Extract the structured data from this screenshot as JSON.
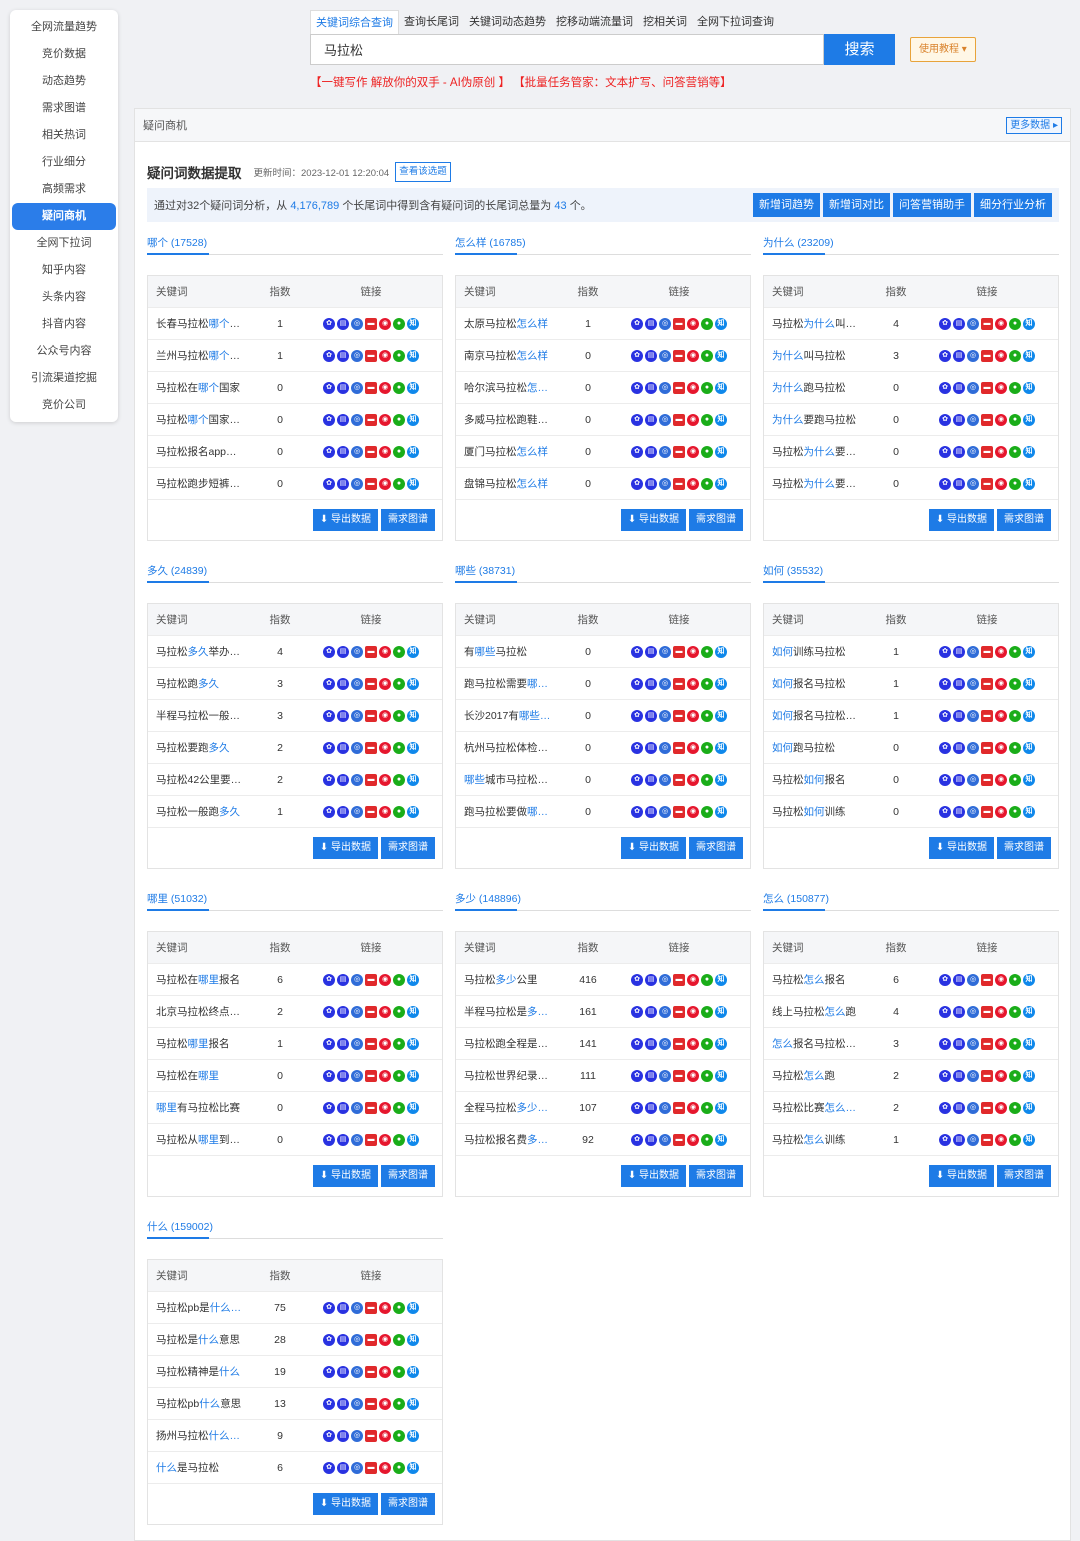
{
  "sidebar": {
    "items": [
      "全网流量趋势",
      "竞价数据",
      "动态趋势",
      "需求图谱",
      "相关热词",
      "行业细分",
      "高频需求",
      "疑问商机",
      "全网下拉词",
      "知乎内容",
      "头条内容",
      "抖音内容",
      "公众号内容",
      "引流渠道挖掘",
      "竞价公司"
    ],
    "active": "疑问商机"
  },
  "search": {
    "tabs": [
      "关键词综合查询",
      "查询长尾词",
      "关键词动态趋势",
      "挖移动端流量词",
      "挖相关词",
      "全网下拉词查询"
    ],
    "value": "马拉松",
    "button": "搜索",
    "tutorial": "使用教程 ▾",
    "promo1": "【一键写作 解放你的双手 - AI伪原创 】",
    "promo2": "【批量任务管家：文本扩写、问答营销等】"
  },
  "panel": {
    "title": "疑问商机",
    "more": "更多数据 ▸",
    "section_title": "疑问词数据提取",
    "update_time": "更新时间：2023-12-01 12:20:04",
    "view_button": "查看该选题",
    "summary_prefix": "通过对32个疑问词分析，从",
    "summary_total": "4,176,789",
    "summary_mid": "个长尾词中得到含有疑问词的长尾词总量为",
    "summary_count": "43",
    "summary_suffix": "个。",
    "buttons": [
      "新增词趋势",
      "新增词对比",
      "问答营销助手",
      "细分行业分析"
    ]
  },
  "table_labels": {
    "keyword": "关键词",
    "index": "指数",
    "link": "链接",
    "export": "导出数据",
    "graph": "需求图谱"
  },
  "link_icons": [
    {
      "name": "baidu-icon",
      "glyph": "✿",
      "color": "#2932e1"
    },
    {
      "name": "page-icon",
      "glyph": "▤",
      "color": "#2932e1"
    },
    {
      "name": "web-icon",
      "glyph": "◎",
      "color": "#2f6cd8"
    },
    {
      "name": "toutiao-icon",
      "glyph": "▬",
      "color": "#e0292b"
    },
    {
      "name": "weibo-icon",
      "glyph": "◉",
      "color": "#e6162d"
    },
    {
      "name": "wechat-icon",
      "glyph": "●",
      "color": "#1aad19"
    },
    {
      "name": "zhihu-icon",
      "glyph": "知",
      "color": "#0f88eb"
    }
  ],
  "groups": [
    {
      "title": "哪个 (17528)",
      "rows": [
        {
          "pre": "长春马拉松",
          "hl": "哪个",
          "post": "…",
          "idx": "1"
        },
        {
          "pre": "兰州马拉松",
          "hl": "哪个",
          "post": "…",
          "idx": "1"
        },
        {
          "pre": "马拉松在",
          "hl": "哪个",
          "post": "国家",
          "idx": "0"
        },
        {
          "pre": "马拉松",
          "hl": "哪个",
          "post": "国家…",
          "idx": "0"
        },
        {
          "pre": "马拉松报名app…",
          "hl": "",
          "post": "",
          "idx": "0"
        },
        {
          "pre": "马拉松跑步短裤…",
          "hl": "",
          "post": "",
          "idx": "0"
        }
      ]
    },
    {
      "title": "怎么样 (16785)",
      "rows": [
        {
          "pre": "太原马拉松",
          "hl": "怎么样",
          "post": "",
          "idx": "1"
        },
        {
          "pre": "南京马拉松",
          "hl": "怎么样",
          "post": "",
          "idx": "0"
        },
        {
          "pre": "哈尔滨马拉松",
          "hl": "怎…",
          "post": "",
          "idx": "0"
        },
        {
          "pre": "多威马拉松跑鞋…",
          "hl": "",
          "post": "",
          "idx": "0"
        },
        {
          "pre": "厦门马拉松",
          "hl": "怎么样",
          "post": "",
          "idx": "0"
        },
        {
          "pre": "盘锦马拉松",
          "hl": "怎么样",
          "post": "",
          "idx": "0"
        }
      ]
    },
    {
      "title": "为什么 (23209)",
      "rows": [
        {
          "pre": "马拉松",
          "hl": "为什么",
          "post": "叫…",
          "idx": "4"
        },
        {
          "pre": "",
          "hl": "为什么",
          "post": "叫马拉松",
          "idx": "3"
        },
        {
          "pre": "",
          "hl": "为什么",
          "post": "跑马拉松",
          "idx": "0"
        },
        {
          "pre": "",
          "hl": "为什么",
          "post": "要跑马拉松",
          "idx": "0"
        },
        {
          "pre": "马拉松",
          "hl": "为什么",
          "post": "要…",
          "idx": "0"
        },
        {
          "pre": "马拉松",
          "hl": "为什么",
          "post": "要…",
          "idx": "0"
        }
      ]
    },
    {
      "title": "多久 (24839)",
      "rows": [
        {
          "pre": "马拉松",
          "hl": "多久",
          "post": "举办…",
          "idx": "4"
        },
        {
          "pre": "马拉松跑",
          "hl": "多久",
          "post": "",
          "idx": "3"
        },
        {
          "pre": "半程马拉松一般…",
          "hl": "",
          "post": "",
          "idx": "3"
        },
        {
          "pre": "马拉松要跑",
          "hl": "多久",
          "post": "",
          "idx": "2"
        },
        {
          "pre": "马拉松42公里要…",
          "hl": "",
          "post": "",
          "idx": "2"
        },
        {
          "pre": "马拉松一般跑",
          "hl": "多久",
          "post": "",
          "idx": "1"
        }
      ]
    },
    {
      "title": "哪些 (38731)",
      "rows": [
        {
          "pre": "有",
          "hl": "哪些",
          "post": "马拉松",
          "idx": "0"
        },
        {
          "pre": "跑马拉松需要",
          "hl": "哪…",
          "post": "",
          "idx": "0"
        },
        {
          "pre": "长沙2017有",
          "hl": "哪些…",
          "post": "",
          "idx": "0"
        },
        {
          "pre": "杭州马拉松体检…",
          "hl": "",
          "post": "",
          "idx": "0"
        },
        {
          "pre": "",
          "hl": "哪些",
          "post": "城市马拉松…",
          "idx": "0"
        },
        {
          "pre": "跑马拉松要做",
          "hl": "哪…",
          "post": "",
          "idx": "0"
        }
      ]
    },
    {
      "title": "如何 (35532)",
      "rows": [
        {
          "pre": "",
          "hl": "如何",
          "post": "训练马拉松",
          "idx": "1"
        },
        {
          "pre": "",
          "hl": "如何",
          "post": "报名马拉松",
          "idx": "1"
        },
        {
          "pre": "",
          "hl": "如何",
          "post": "报名马拉松…",
          "idx": "1"
        },
        {
          "pre": "",
          "hl": "如何",
          "post": "跑马拉松",
          "idx": "0"
        },
        {
          "pre": "马拉松",
          "hl": "如何",
          "post": "报名",
          "idx": "0"
        },
        {
          "pre": "马拉松",
          "hl": "如何",
          "post": "训练",
          "idx": "0"
        }
      ]
    },
    {
      "title": "哪里 (51032)",
      "rows": [
        {
          "pre": "马拉松在",
          "hl": "哪里",
          "post": "报名",
          "idx": "6"
        },
        {
          "pre": "北京马拉松终点…",
          "hl": "",
          "post": "",
          "idx": "2"
        },
        {
          "pre": "马拉松",
          "hl": "哪里",
          "post": "报名",
          "idx": "1"
        },
        {
          "pre": "马拉松在",
          "hl": "哪里",
          "post": "",
          "idx": "0"
        },
        {
          "pre": "",
          "hl": "哪里",
          "post": "有马拉松比赛",
          "idx": "0"
        },
        {
          "pre": "马拉松从",
          "hl": "哪里",
          "post": "到…",
          "idx": "0"
        }
      ]
    },
    {
      "title": "多少 (148896)",
      "rows": [
        {
          "pre": "马拉松",
          "hl": "多少",
          "post": "公里",
          "idx": "416"
        },
        {
          "pre": "半程马拉松是",
          "hl": "多…",
          "post": "",
          "idx": "161"
        },
        {
          "pre": "马拉松跑全程是…",
          "hl": "",
          "post": "",
          "idx": "141"
        },
        {
          "pre": "马拉松世界纪录…",
          "hl": "",
          "post": "",
          "idx": "111"
        },
        {
          "pre": "全程马拉松",
          "hl": "多少…",
          "post": "",
          "idx": "107"
        },
        {
          "pre": "马拉松报名费",
          "hl": "多…",
          "post": "",
          "idx": "92"
        }
      ]
    },
    {
      "title": "怎么 (150877)",
      "rows": [
        {
          "pre": "马拉松",
          "hl": "怎么",
          "post": "报名",
          "idx": "6"
        },
        {
          "pre": "线上马拉松",
          "hl": "怎么",
          "post": "跑",
          "idx": "4"
        },
        {
          "pre": "",
          "hl": "怎么",
          "post": "报名马拉松…",
          "idx": "3"
        },
        {
          "pre": "马拉松",
          "hl": "怎么",
          "post": "跑",
          "idx": "2"
        },
        {
          "pre": "马拉松比赛",
          "hl": "怎么…",
          "post": "",
          "idx": "2"
        },
        {
          "pre": "马拉松",
          "hl": "怎么",
          "post": "训练",
          "idx": "1"
        }
      ]
    },
    {
      "title": "什么 (159002)",
      "rows": [
        {
          "pre": "马拉松pb是",
          "hl": "什么…",
          "post": "",
          "idx": "75"
        },
        {
          "pre": "马拉松是",
          "hl": "什么",
          "post": "意思",
          "idx": "28"
        },
        {
          "pre": "马拉松精神是",
          "hl": "什么",
          "post": "",
          "idx": "19"
        },
        {
          "pre": "马拉松pb",
          "hl": "什么",
          "post": "意思",
          "idx": "13"
        },
        {
          "pre": "扬州马拉松",
          "hl": "什么…",
          "post": "",
          "idx": "9"
        },
        {
          "pre": "",
          "hl": "什么",
          "post": "是马拉松",
          "idx": "6"
        }
      ]
    }
  ]
}
